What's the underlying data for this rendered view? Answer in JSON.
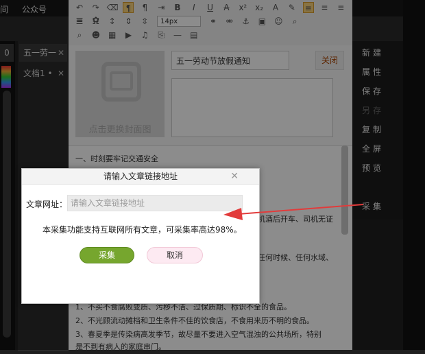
{
  "topbar": {
    "tab_left": "间",
    "tab_public": "公众号"
  },
  "left": {
    "panel_tab": "0"
  },
  "doc_tabs": [
    {
      "label": "五一劳一",
      "close": "✕"
    },
    {
      "label": "文档1 •",
      "close": "✕"
    }
  ],
  "toolbar": {
    "font_size": "14px"
  },
  "cover": {
    "text": "点击更换封面图"
  },
  "title": {
    "value": "五一劳动节放假通知",
    "close_label": "关闭"
  },
  "content_lines": [
    "一、时刻要牢记交通安全",
    "机酒后开车、司机无证",
    "任何时候、任何水域、",
    "1、不买不食腐败变质、污秽不洁、过保质期、标识不全的食品。",
    "2、不光顾流动摊档和卫生条件不佳的饮食店，不食用来历不明的食品。",
    "3、春夏季是传染病高发季节，故尽量不要进入空气混浊的公共场所，特别",
    "是不到有病人的家庭串门。"
  ],
  "right_menu": [
    "新建",
    "属性",
    "保存",
    "另存",
    "复制",
    "全屏",
    "预览",
    "采集"
  ],
  "dialog": {
    "title": "请输入文章链接地址",
    "close": "✕",
    "url_label": "文章网址：",
    "url_placeholder": "请输入文章链接地址",
    "hint": "本采集功能支持互联网所有文章，可采集率高达98%。",
    "collect_label": "采集",
    "cancel_label": "取消"
  }
}
